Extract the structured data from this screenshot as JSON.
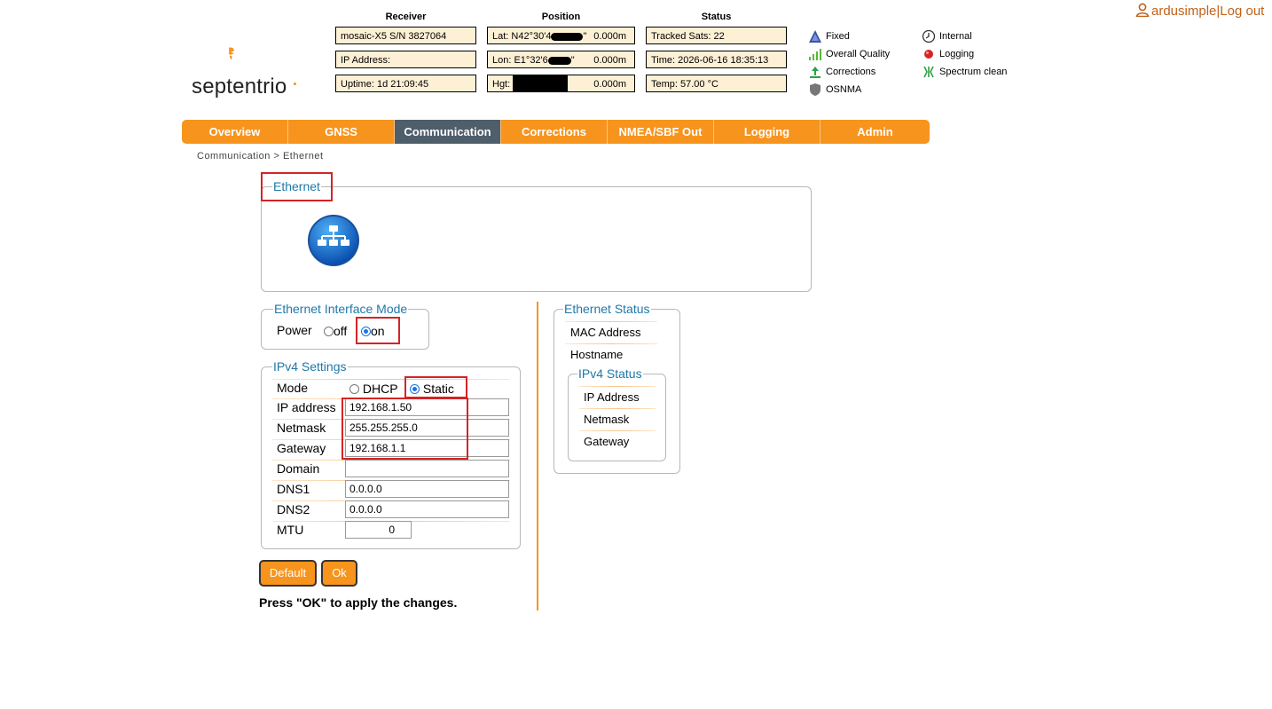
{
  "user": {
    "name": "ardusimple",
    "separator": "|",
    "logout": "Log out"
  },
  "brand": {
    "name": "septentrio"
  },
  "header": {
    "receiver": {
      "title": "Receiver",
      "lines": [
        "mosaic-X5 S/N 3827064",
        "IP Address:",
        "Uptime: 1d 21:09:45"
      ]
    },
    "position": {
      "title": "Position",
      "lat_prefix": "Lat:  N42°30'4",
      "lat_suffix": "\"",
      "lat_alt": "0.000m",
      "lon_prefix": "Lon: E1°32'6",
      "lon_suffix": "\"",
      "lon_alt": "0.000m",
      "hgt_prefix": "Hgt:",
      "hgt_alt": "0.000m"
    },
    "status": {
      "title": "Status",
      "lines": [
        "Tracked Sats: 22",
        "Time: 2026-06-16 18:35:13",
        "Temp: 57.00 °C"
      ]
    }
  },
  "legend": {
    "left": [
      {
        "label": "Fixed",
        "icon": "triangle-icon",
        "color": "#3a52a8"
      },
      {
        "label": "Overall Quality",
        "icon": "signal-bars-icon",
        "color": "#5bb83a"
      },
      {
        "label": "Corrections",
        "icon": "upload-arrow-icon",
        "color": "#2ea043"
      },
      {
        "label": "OSNMA",
        "icon": "shield-icon",
        "color": "#777777"
      }
    ],
    "right": [
      {
        "label": "Internal",
        "icon": "clock-icon",
        "color": "#333333"
      },
      {
        "label": "Logging",
        "icon": "red-dot-icon",
        "color": "#d42426"
      },
      {
        "label": "Spectrum clean",
        "icon": "spectrum-icon",
        "color": "#2ea043"
      }
    ]
  },
  "nav": {
    "tabs": [
      "Overview",
      "GNSS",
      "Communication",
      "Corrections",
      "NMEA/SBF Out",
      "Logging",
      "Admin"
    ],
    "active": "Communication"
  },
  "breadcrumb": "Communication > Ethernet",
  "ethernet": {
    "title": "Ethernet"
  },
  "interface_mode": {
    "title": "Ethernet Interface Mode",
    "power_label": "Power",
    "off_label": "off",
    "on_label": "on",
    "selected": "on"
  },
  "ipv4": {
    "title": "IPv4 Settings",
    "mode_label": "Mode",
    "dhcp_label": "DHCP",
    "static_label": "Static",
    "selected": "Static",
    "ip_label": "IP address",
    "ip_value": "192.168.1.50",
    "netmask_label": "Netmask",
    "netmask_value": "255.255.255.0",
    "gateway_label": "Gateway",
    "gateway_value": "192.168.1.1",
    "domain_label": "Domain",
    "domain_value": "",
    "dns1_label": "DNS1",
    "dns1_value": "0.0.0.0",
    "dns2_label": "DNS2",
    "dns2_value": "0.0.0.0",
    "mtu_label": "MTU",
    "mtu_value": "0"
  },
  "buttons": {
    "default": "Default",
    "ok": "Ok"
  },
  "hint": "Press \"OK\" to apply the changes.",
  "ethernet_status": {
    "title": "Ethernet Status",
    "mac_label": "MAC Address",
    "hostname_label": "Hostname",
    "ipv4_status": {
      "title": "IPv4 Status",
      "ip_label": "IP Address",
      "netmask_label": "Netmask",
      "gateway_label": "Gateway"
    }
  }
}
